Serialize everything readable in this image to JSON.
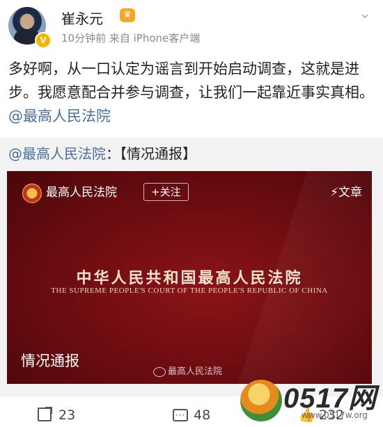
{
  "post": {
    "author": "崔永元",
    "time_source": "10分钟前   来自 iPhone客户端",
    "text_plain": "多好啊，从一口认定为谣言到开始启动调查，这就是进步。我愿意配合并参与调查，让我们一起靠近事实真相。",
    "text_mention": "@最高人民法院"
  },
  "repost": {
    "mention": "@最高人民法院",
    "rest": "：【情况通报】",
    "card": {
      "source": "最高人民法院",
      "follow_label": "+关注",
      "article_label": "⚡文章",
      "court_cn": "中华人民共和国最高人民法院",
      "court_en": "THE SUPREME PEOPLE'S COURT OF THE PEOPLE'S REPUBLIC OF CHINA",
      "title": "情况通报",
      "watermark": "最高人民法院"
    }
  },
  "actions": {
    "share_count": "23",
    "comment_count": "48",
    "like_count": "232"
  },
  "logo": {
    "text": "0517网",
    "url": "www.0517w.org"
  },
  "icons": {
    "verify": "v-badge-icon",
    "vip": "crown-icon",
    "menu": "chevron-down-icon",
    "share": "share-icon",
    "comment": "comment-icon",
    "like": "thumbs-up-icon"
  },
  "colors": {
    "mention": "#496f9e",
    "card_bg": "#6a0c10",
    "verify_badge": "#f7b500"
  }
}
